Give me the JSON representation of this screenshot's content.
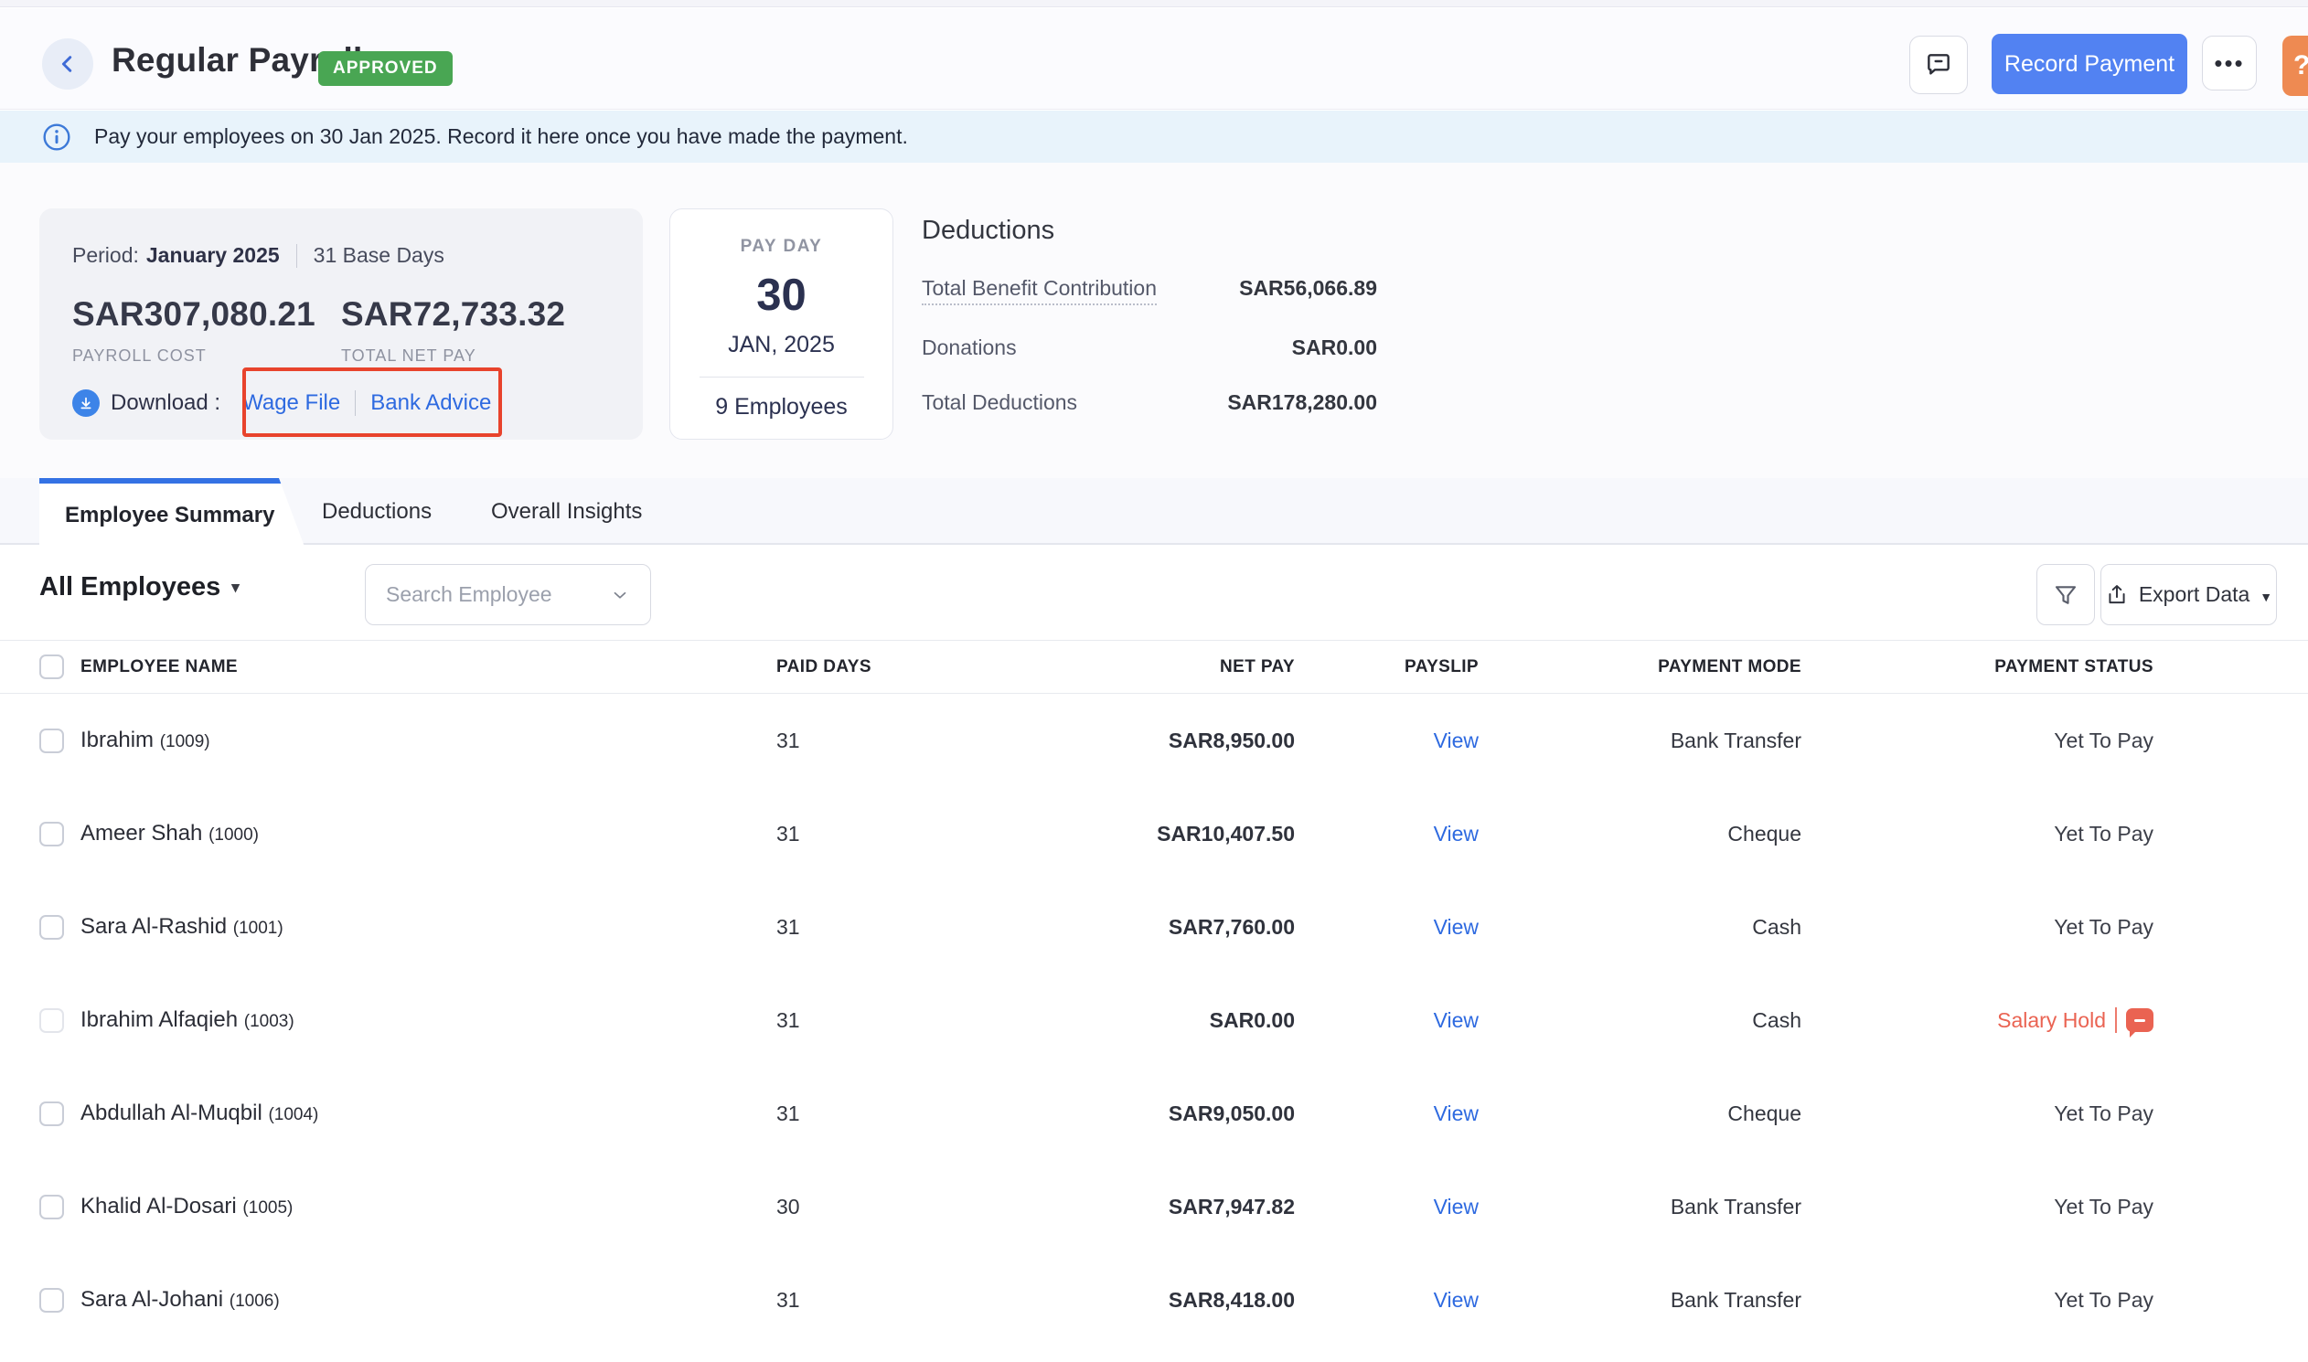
{
  "header": {
    "title": "Regular Payroll",
    "status_badge": "APPROVED",
    "record_payment_label": "Record Payment",
    "more_label": "...",
    "help_label": "?"
  },
  "banner": {
    "text": "Pay your employees on 30 Jan 2025. Record it here once you have made the payment."
  },
  "summary": {
    "period_label": "Period:",
    "period_value": "January 2025",
    "base_days": "31 Base Days",
    "payroll_cost": "SAR307,080.21",
    "payroll_cost_label": "PAYROLL COST",
    "total_net_pay": "SAR72,733.32",
    "total_net_pay_label": "TOTAL NET PAY",
    "download_label": "Download :",
    "wage_file_link": "Wage File",
    "bank_advice_link": "Bank Advice"
  },
  "payday": {
    "label": "PAY DAY",
    "day": "30",
    "month_year": "JAN, 2025",
    "employees": "9 Employees"
  },
  "deductions_panel": {
    "title": "Deductions",
    "rows": [
      {
        "label": "Total Benefit Contribution",
        "value": "SAR56,066.89"
      },
      {
        "label": "Donations",
        "value": "SAR0.00"
      },
      {
        "label": "Total Deductions",
        "value": "SAR178,280.00"
      }
    ]
  },
  "tabs": [
    {
      "label": "Employee Summary",
      "active": true
    },
    {
      "label": "Deductions",
      "active": false
    },
    {
      "label": "Overall Insights",
      "active": false
    }
  ],
  "toolbar": {
    "scope_label": "All Employees",
    "search_placeholder": "Search Employee",
    "export_label": "Export Data"
  },
  "table": {
    "columns": [
      "EMPLOYEE NAME",
      "PAID DAYS",
      "NET PAY",
      "PAYSLIP",
      "PAYMENT MODE",
      "PAYMENT STATUS"
    ],
    "payslip_link_label": "View",
    "rows": [
      {
        "name": "Ibrahim",
        "employee_number": "(1009)",
        "paid_days": "31",
        "net_pay": "SAR8,950.00",
        "payment_mode": "Bank Transfer",
        "payment_status": "Yet To Pay",
        "status_type": "normal",
        "selectable": true
      },
      {
        "name": "Ameer Shah",
        "employee_number": "(1000)",
        "paid_days": "31",
        "net_pay": "SAR10,407.50",
        "payment_mode": "Cheque",
        "payment_status": "Yet To Pay",
        "status_type": "normal",
        "selectable": true
      },
      {
        "name": "Sara Al-Rashid",
        "employee_number": "(1001)",
        "paid_days": "31",
        "net_pay": "SAR7,760.00",
        "payment_mode": "Cash",
        "payment_status": "Yet To Pay",
        "status_type": "normal",
        "selectable": true
      },
      {
        "name": "Ibrahim Alfaqieh",
        "employee_number": "(1003)",
        "paid_days": "31",
        "net_pay": "SAR0.00",
        "payment_mode": "Cash",
        "payment_status": "Salary Hold",
        "status_type": "hold",
        "selectable": false
      },
      {
        "name": "Abdullah Al-Muqbil",
        "employee_number": "(1004)",
        "paid_days": "31",
        "net_pay": "SAR9,050.00",
        "payment_mode": "Cheque",
        "payment_status": "Yet To Pay",
        "status_type": "normal",
        "selectable": true
      },
      {
        "name": "Khalid Al-Dosari",
        "employee_number": "(1005)",
        "paid_days": "30",
        "net_pay": "SAR7,947.82",
        "payment_mode": "Bank Transfer",
        "payment_status": "Yet To Pay",
        "status_type": "normal",
        "selectable": true
      },
      {
        "name": "Sara Al-Johani",
        "employee_number": "(1006)",
        "paid_days": "31",
        "net_pay": "SAR8,418.00",
        "payment_mode": "Bank Transfer",
        "payment_status": "Yet To Pay",
        "status_type": "normal",
        "selectable": true
      }
    ]
  },
  "colors": {
    "accent_blue": "#5282f2",
    "link_blue": "#2e6ae0",
    "approved_green": "#49a653",
    "banner_blue": "#e8f3fb",
    "annotation_red": "#e8432c",
    "hold_red": "#ea6352",
    "help_orange": "#ee8a52"
  }
}
